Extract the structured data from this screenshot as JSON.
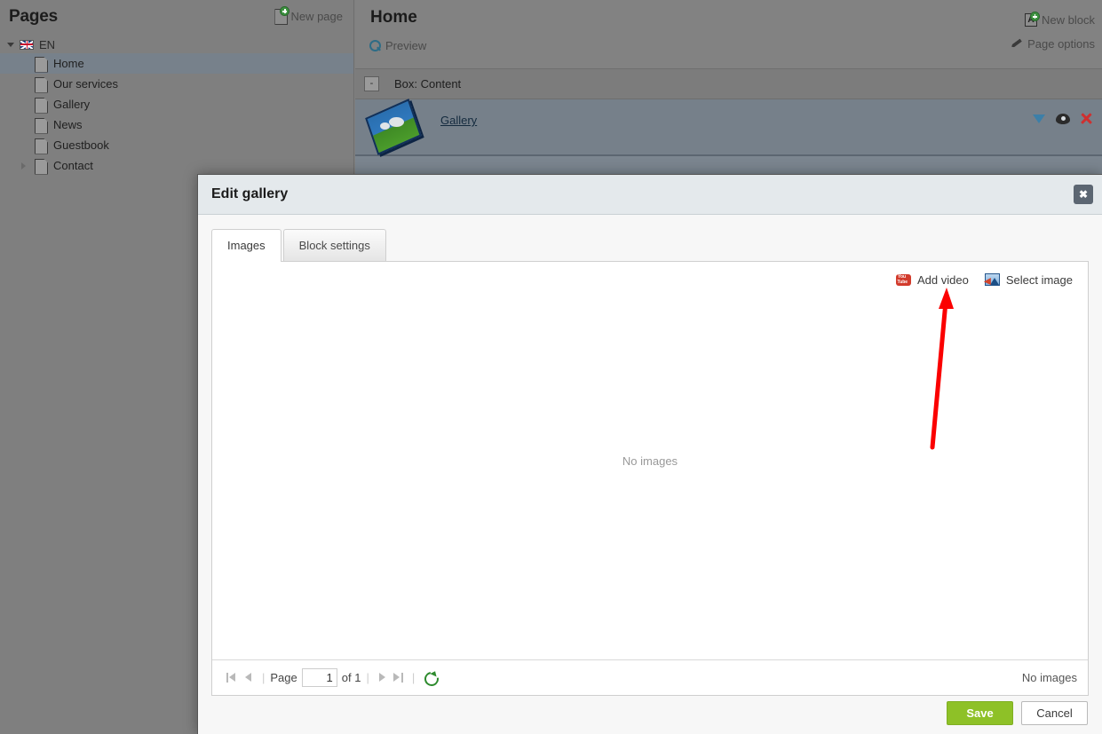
{
  "sidebar": {
    "title": "Pages",
    "new_page_label": "New page",
    "language": {
      "code": "EN",
      "flag": "uk-flag-icon"
    },
    "items": [
      {
        "label": "Home",
        "selected": true,
        "expandable": false
      },
      {
        "label": "Our services",
        "selected": false,
        "expandable": false
      },
      {
        "label": "Gallery",
        "selected": false,
        "expandable": false
      },
      {
        "label": "News",
        "selected": false,
        "expandable": false
      },
      {
        "label": "Guestbook",
        "selected": false,
        "expandable": false
      },
      {
        "label": "Contact",
        "selected": false,
        "expandable": true
      }
    ]
  },
  "content": {
    "page_title": "Home",
    "preview_label": "Preview",
    "new_block_label": "New block",
    "page_options_label": "Page options",
    "box": {
      "collapse_label": "-",
      "label": "Box: Content"
    },
    "block": {
      "link_label": "Gallery",
      "actions": [
        "chevron-down-icon",
        "eye-icon",
        "delete-x-icon"
      ]
    }
  },
  "modal": {
    "title": "Edit gallery",
    "close_label": "✖",
    "tabs": [
      {
        "label": "Images",
        "active": true
      },
      {
        "label": "Block settings",
        "active": false
      }
    ],
    "toolbar": {
      "add_video_label": "Add video",
      "select_image_label": "Select image"
    },
    "empty_message": "No images",
    "pager": {
      "page_label": "Page",
      "page_value": "1",
      "of_label": "of 1",
      "separator": "|",
      "status": "No images"
    },
    "save_label": "Save",
    "cancel_label": "Cancel"
  },
  "annotation": {
    "type": "arrow",
    "color": "#fb0000",
    "points_to": "select-image-button"
  },
  "colors": {
    "accent_green": "#8ec127",
    "link_blue": "#3c7fa8",
    "danger_red": "#cf3030",
    "annotation_red": "#fb0000",
    "modal_header": "#e4e9ec",
    "overlay": "#808080"
  }
}
